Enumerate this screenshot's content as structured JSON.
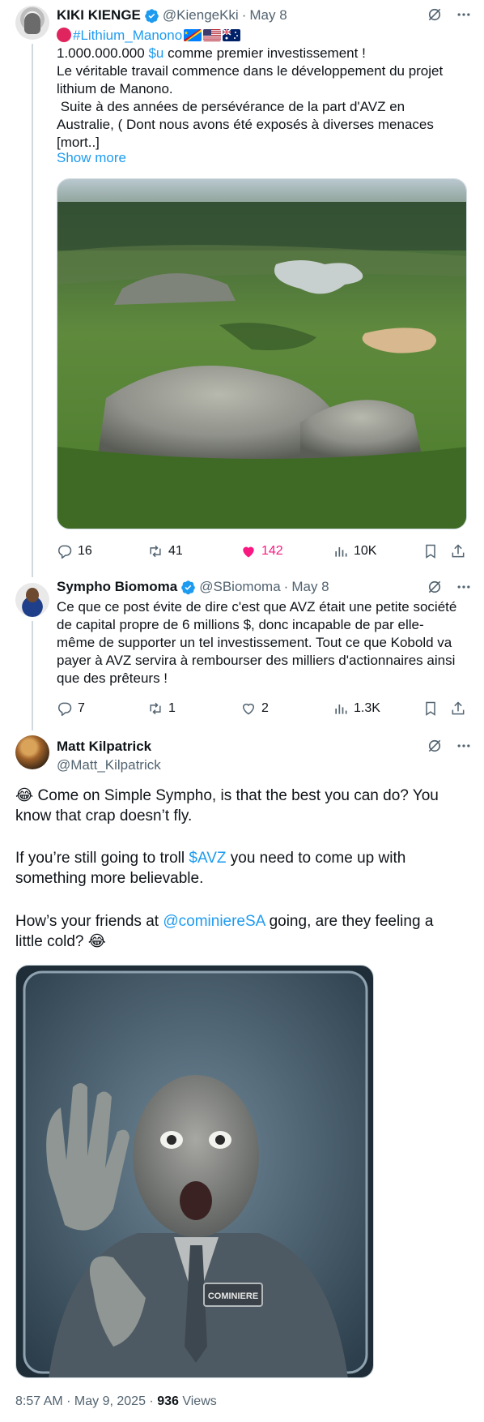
{
  "tweet1": {
    "name": "KIKI KIENGE",
    "handle": "@KiengeKki",
    "date": "May 8",
    "hashtag": "#Lithium_Manono",
    "line1_amount": "1.000.000.000",
    "line1_cashtag": "$u",
    "line1_rest": "comme premier investissement !",
    "lines": [
      "Le véritable travail commence dans le développement du projet",
      "lithium de Manono.",
      " Suite à des années de persévérance de la part d'AVZ en",
      "Australie, ( Dont nous avons été exposés à diverses menaces",
      "[mort..]"
    ],
    "show_more": "Show more",
    "stats": {
      "replies": "16",
      "retweets": "41",
      "likes": "142",
      "views": "10K"
    }
  },
  "tweet2": {
    "name": "Sympho Biomoma",
    "handle": "@SBiomoma",
    "date": "May 8",
    "lines": [
      "Ce que ce post évite de dire c'est que AVZ était une petite société",
      "de capital propre de 6 millions $, donc incapable de par elle-",
      "même de supporter un tel investissement. Tout ce que Kobold va",
      "payer à AVZ servira à rembourser des milliers d'actionnaires ainsi",
      "que des prêteurs !"
    ],
    "stats": {
      "replies": "7",
      "retweets": "1",
      "likes": "2",
      "views": "1.3K"
    }
  },
  "tweet3": {
    "name": "Matt Kilpatrick",
    "handle": "@Matt_Kilpatrick",
    "p1_line1": "😂 Come on Simple Sympho, is that the best you can do? You",
    "p1_line2": "know that crap doesn’t fly.",
    "p2_pre": "If you’re still going to troll ",
    "p2_cashtag": "$AVZ",
    "p2_post": " you need to come up with",
    "p2_line2": "something more believable.",
    "p3_pre": "How’s your friends at ",
    "p3_mention": "@cominiereSA",
    "p3_post": " going, are they feeling a",
    "p3_line2": "little cold? 😂",
    "badge_text": "COMINIERE"
  },
  "footer": {
    "time": "8:57 AM · May 9, 2025 · ",
    "views_count": "936",
    "views_label": " Views"
  },
  "colors": {
    "accent": "#1d9bf0",
    "like_active": "#f91880",
    "muted": "#536471"
  }
}
